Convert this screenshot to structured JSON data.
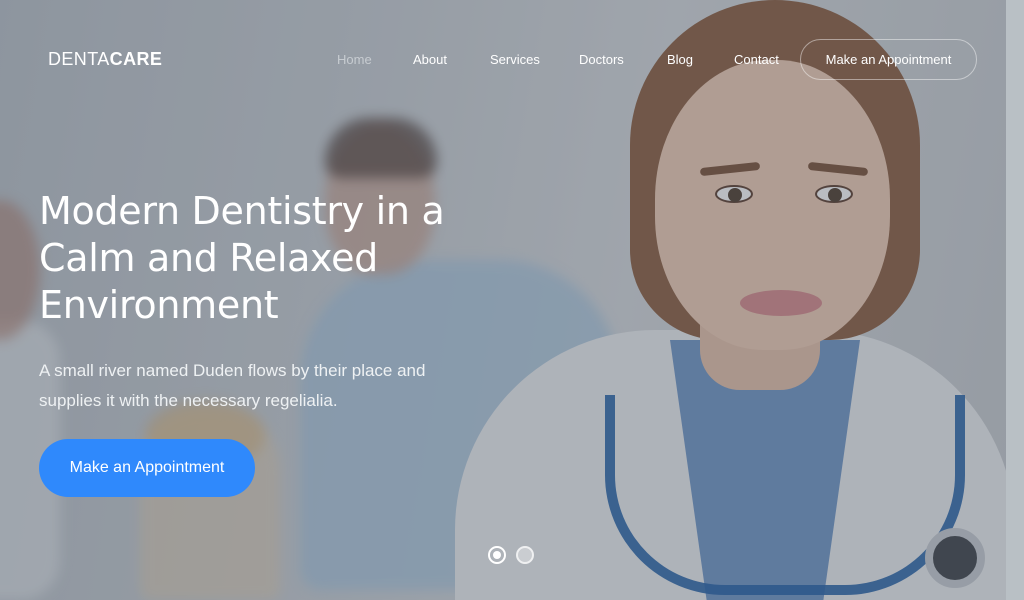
{
  "brand": {
    "prefix": "DENTA",
    "suffix": "CARE"
  },
  "nav": {
    "items": [
      {
        "label": "Home",
        "active": true
      },
      {
        "label": "About",
        "active": false
      },
      {
        "label": "Services",
        "active": false
      },
      {
        "label": "Doctors",
        "active": false
      },
      {
        "label": "Blog",
        "active": false
      },
      {
        "label": "Contact",
        "active": false
      }
    ],
    "cta_label": "Make an Appointment"
  },
  "hero": {
    "headline": "Modern Dentistry in a Calm and Relaxed Environment",
    "subtext": "A small river named Duden flows by their place and supplies it with the necessary regelialia.",
    "cta_label": "Make an Appointment",
    "slides": {
      "count": 2,
      "active": 1
    }
  },
  "colors": {
    "accent": "#2f89fc",
    "text": "#ffffff",
    "nav_active": "#c7ccd1"
  }
}
